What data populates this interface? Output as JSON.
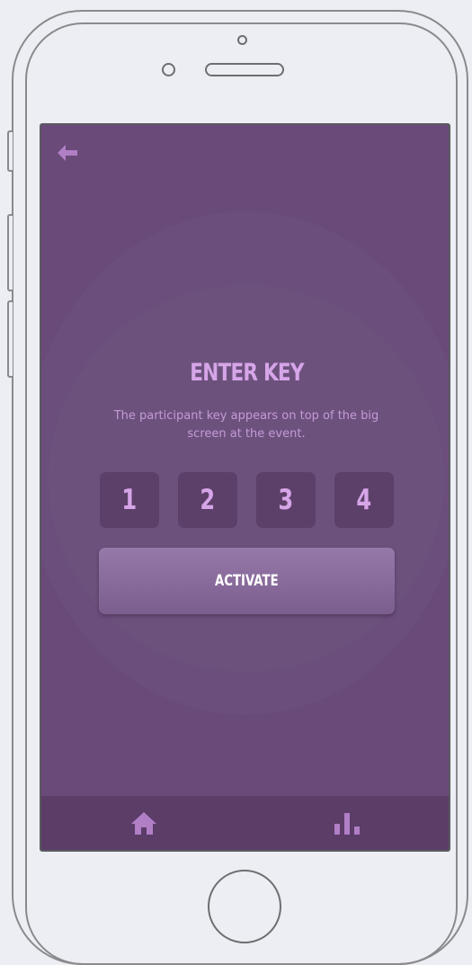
{
  "header": {
    "back_icon": "arrow-left-icon"
  },
  "main": {
    "title": "ENTER KEY",
    "description": "The participant key appears on top of the big screen at the event.",
    "key_digits": [
      "1",
      "2",
      "3",
      "4"
    ],
    "activate_label": "ACTIVATE"
  },
  "tabbar": {
    "items": [
      {
        "icon": "home-icon"
      },
      {
        "icon": "bar-chart-icon"
      }
    ]
  },
  "colors": {
    "screen_background": "#6a4a78",
    "accent_text": "#d6a5e8",
    "digit_box": "#5d4069",
    "button": "#8a6b9c",
    "tabbar": "#5b3d68",
    "icon": "#b07fc6"
  }
}
